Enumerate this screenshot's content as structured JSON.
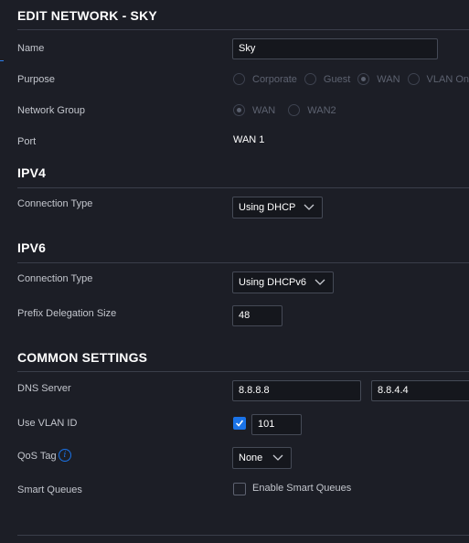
{
  "header": {
    "title": "EDIT NETWORK - SKY"
  },
  "name": {
    "label": "Name",
    "value": "Sky"
  },
  "purpose": {
    "label": "Purpose",
    "options": [
      {
        "label": "Corporate",
        "checked": false
      },
      {
        "label": "Guest",
        "checked": false
      },
      {
        "label": "WAN",
        "checked": true
      },
      {
        "label": "VLAN On",
        "checked": false
      }
    ]
  },
  "network_group": {
    "label": "Network Group",
    "options": [
      {
        "label": "WAN",
        "checked": true
      },
      {
        "label": "WAN2",
        "checked": false
      }
    ]
  },
  "port": {
    "label": "Port",
    "value": "WAN 1"
  },
  "ipv4": {
    "title": "IPV4",
    "connection_type_label": "Connection Type",
    "connection_type_value": "Using DHCP"
  },
  "ipv6": {
    "title": "IPV6",
    "connection_type_label": "Connection Type",
    "connection_type_value": "Using DHCPv6",
    "prefix_label": "Prefix Delegation Size",
    "prefix_value": "48"
  },
  "common": {
    "title": "COMMON SETTINGS",
    "dns_label": "DNS Server",
    "dns_primary": "8.8.8.8",
    "dns_secondary": "8.8.4.4",
    "vlan_label": "Use VLAN ID",
    "vlan_checked": true,
    "vlan_value": "101",
    "qos_label": "QoS Tag",
    "qos_value": "None",
    "smart_queues_label": "Smart Queues",
    "smart_queues_option": "Enable Smart Queues",
    "smart_queues_checked": false
  },
  "colors": {
    "accent": "#1a73e8",
    "background": "#1c1e26",
    "input_bg": "#15171d"
  },
  "icons": {
    "dropdown": "chevron-down-icon",
    "info": "info-icon",
    "check": "check-icon"
  }
}
